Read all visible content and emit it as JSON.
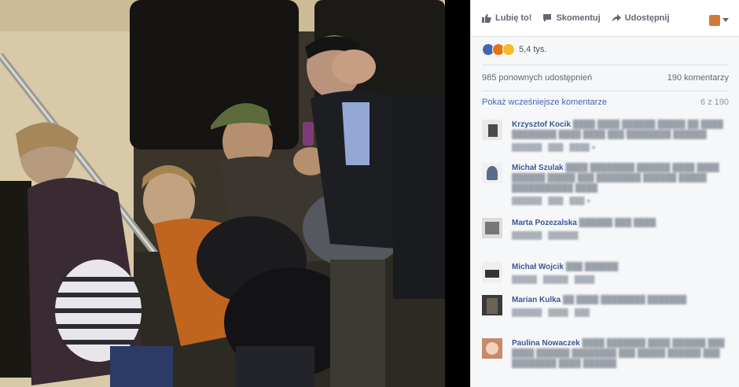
{
  "actions": {
    "like": "Lubię to!",
    "comment": "Skomentuj",
    "share": "Udostępnij"
  },
  "reactions": {
    "count": "5,4 tys."
  },
  "stats": {
    "shares": "985 ponownych udostępnień",
    "comments": "190 komentarzy"
  },
  "more_comments": {
    "label": "Pokaż wcześniejsze komentarze",
    "count": "6 z 190"
  },
  "comments": [
    {
      "name": "Krzysztof Kocik"
    },
    {
      "name": "Michał Szulak"
    },
    {
      "name": "Marta Pozezalska"
    },
    {
      "name": "Michał Wojcik"
    },
    {
      "name": "Marian Kulka"
    },
    {
      "name": "Paulina Nowaczek"
    }
  ],
  "colors": {
    "link": "#4267b2",
    "name": "#385898",
    "like_blue": "#4267b2",
    "panel_bg": "#f6f7f9"
  }
}
